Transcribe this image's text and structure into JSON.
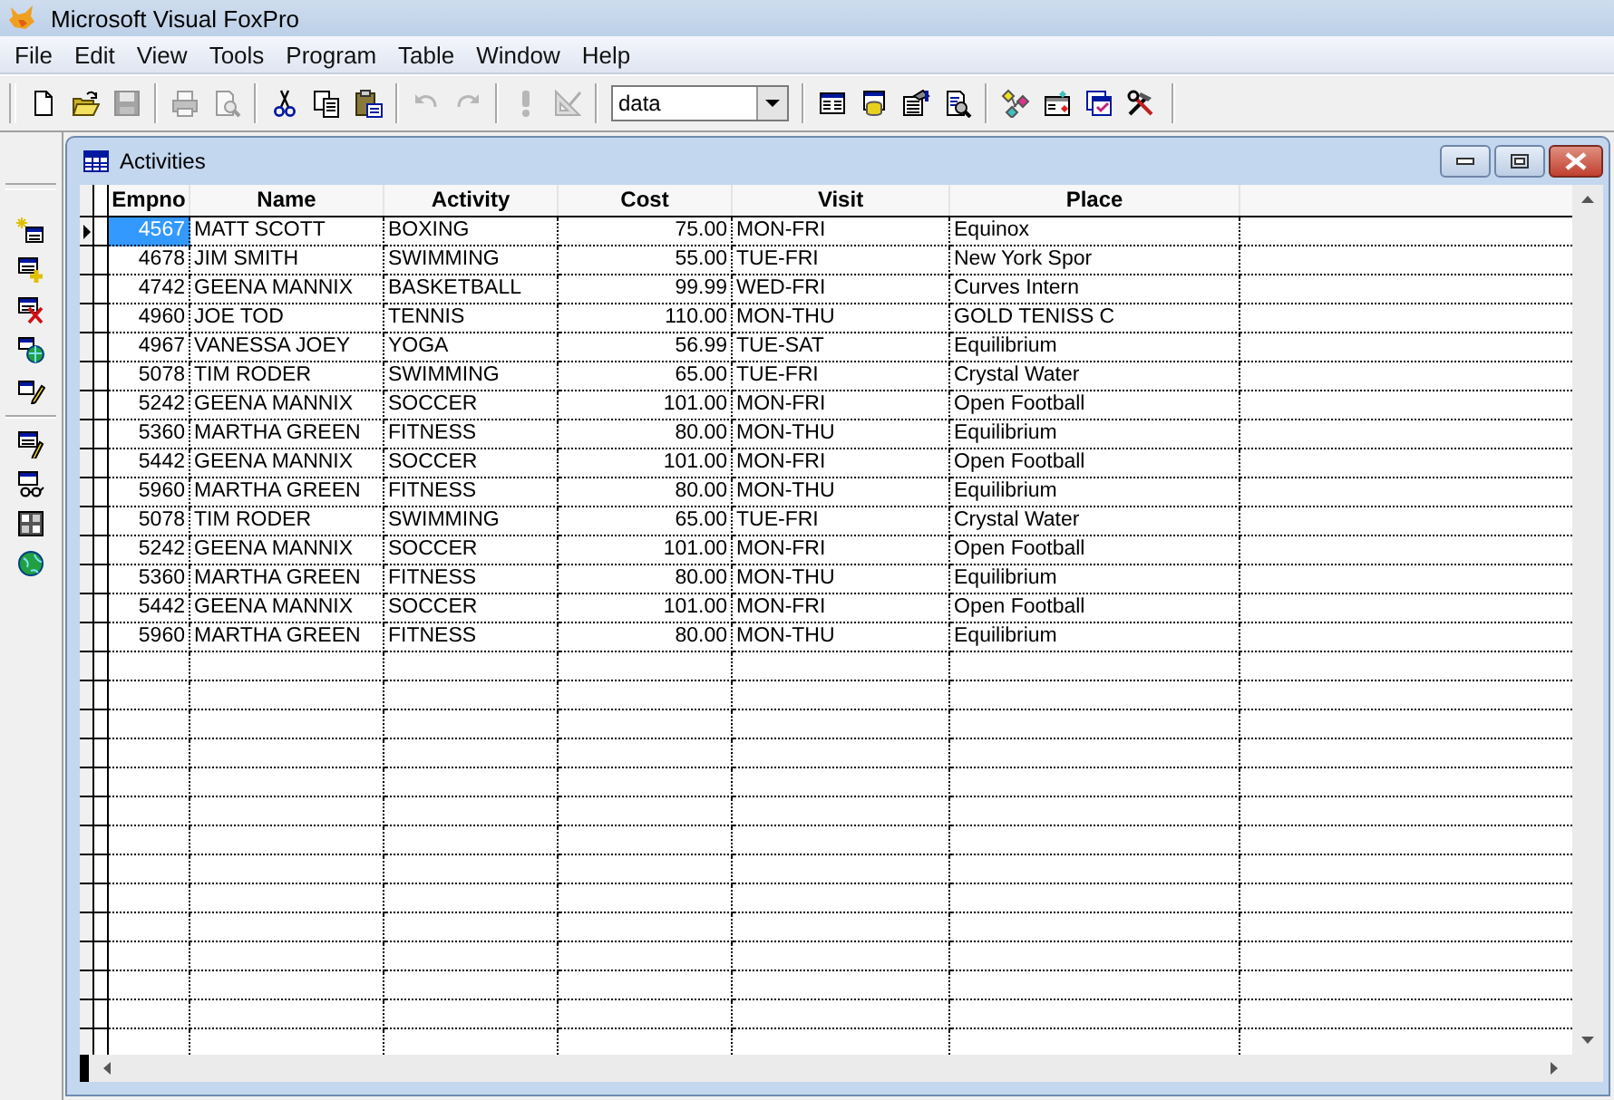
{
  "app": {
    "title": "Microsoft Visual FoxPro"
  },
  "menu": [
    "File",
    "Edit",
    "View",
    "Tools",
    "Program",
    "Table",
    "Window",
    "Help"
  ],
  "toolbar": [
    {
      "kind": "new",
      "disabled": false
    },
    {
      "kind": "open",
      "disabled": false
    },
    {
      "kind": "save",
      "disabled": true
    },
    {
      "kind": "separator"
    },
    {
      "kind": "print",
      "disabled": true
    },
    {
      "kind": "preview",
      "disabled": true
    },
    {
      "kind": "separator"
    },
    {
      "kind": "cut",
      "disabled": false
    },
    {
      "kind": "copy",
      "disabled": false
    },
    {
      "kind": "paste",
      "disabled": false
    },
    {
      "kind": "separator"
    },
    {
      "kind": "undo",
      "disabled": true
    },
    {
      "kind": "redo",
      "disabled": true
    },
    {
      "kind": "separator"
    },
    {
      "kind": "run",
      "disabled": true
    },
    {
      "kind": "modify",
      "disabled": true
    },
    {
      "kind": "separator"
    },
    {
      "kind": "combo",
      "value": "data"
    },
    {
      "kind": "separator"
    },
    {
      "kind": "command",
      "disabled": false
    },
    {
      "kind": "datasession",
      "disabled": false
    },
    {
      "kind": "properties",
      "disabled": false
    },
    {
      "kind": "report",
      "disabled": false
    },
    {
      "kind": "separator"
    },
    {
      "kind": "connect",
      "disabled": false
    },
    {
      "kind": "wizard",
      "disabled": false
    },
    {
      "kind": "formdesign",
      "disabled": false
    },
    {
      "kind": "tools",
      "disabled": false
    }
  ],
  "side_toolbar": [
    {
      "kind": "newclass"
    },
    {
      "kind": "add"
    },
    {
      "kind": "remove"
    },
    {
      "kind": "browse"
    },
    {
      "kind": "modifywin"
    },
    {
      "kind": "separator"
    },
    {
      "kind": "edit"
    },
    {
      "kind": "view"
    },
    {
      "kind": "binary"
    },
    {
      "kind": "globe"
    }
  ],
  "window": {
    "title": "Activities",
    "columns": [
      {
        "label": "Empno",
        "numeric": true
      },
      {
        "label": "Name",
        "numeric": false
      },
      {
        "label": "Activity",
        "numeric": false
      },
      {
        "label": "Cost",
        "numeric": true
      },
      {
        "label": "Visit",
        "numeric": false
      },
      {
        "label": "Place",
        "numeric": false
      }
    ],
    "rows": [
      {
        "selected": true,
        "cells": [
          "4567",
          "MATT SCOTT",
          "BOXING",
          "75.00",
          "MON-FRI",
          "Equinox"
        ]
      },
      {
        "selected": false,
        "cells": [
          "4678",
          "JIM SMITH",
          "SWIMMING",
          "55.00",
          "TUE-FRI",
          "New York Spor"
        ]
      },
      {
        "selected": false,
        "cells": [
          "4742",
          "GEENA MANNIX",
          "BASKETBALL",
          "99.99",
          "WED-FRI",
          "Curves Intern"
        ]
      },
      {
        "selected": false,
        "cells": [
          "4960",
          "JOE TOD",
          "TENNIS",
          "110.00",
          "MON-THU",
          "GOLD TENISS C"
        ]
      },
      {
        "selected": false,
        "cells": [
          "4967",
          "VANESSA JOEY",
          "YOGA",
          "56.99",
          "TUE-SAT",
          "Equilibrium"
        ]
      },
      {
        "selected": false,
        "cells": [
          "5078",
          "TIM RODER",
          "SWIMMING",
          "65.00",
          "TUE-FRI",
          "Crystal Water"
        ]
      },
      {
        "selected": false,
        "cells": [
          "5242",
          "GEENA MANNIX",
          "SOCCER",
          "101.00",
          "MON-FRI",
          "Open Football"
        ]
      },
      {
        "selected": false,
        "cells": [
          "5360",
          "MARTHA GREEN",
          "FITNESS",
          "80.00",
          "MON-THU",
          "Equilibrium"
        ]
      },
      {
        "selected": false,
        "cells": [
          "5442",
          "GEENA MANNIX",
          "SOCCER",
          "101.00",
          "MON-FRI",
          "Open Football"
        ]
      },
      {
        "selected": false,
        "cells": [
          "5960",
          "MARTHA GREEN",
          "FITNESS",
          "80.00",
          "MON-THU",
          "Equilibrium"
        ]
      },
      {
        "selected": false,
        "cells": [
          "5078",
          "TIM RODER",
          "SWIMMING",
          "65.00",
          "TUE-FRI",
          "Crystal Water"
        ]
      },
      {
        "selected": false,
        "cells": [
          "5242",
          "GEENA MANNIX",
          "SOCCER",
          "101.00",
          "MON-FRI",
          "Open Football"
        ]
      },
      {
        "selected": false,
        "cells": [
          "5360",
          "MARTHA GREEN",
          "FITNESS",
          "80.00",
          "MON-THU",
          "Equilibrium"
        ]
      },
      {
        "selected": false,
        "cells": [
          "5442",
          "GEENA MANNIX",
          "SOCCER",
          "101.00",
          "MON-FRI",
          "Open Football"
        ]
      },
      {
        "selected": false,
        "cells": [
          "5960",
          "MARTHA GREEN",
          "FITNESS",
          "80.00",
          "MON-THU",
          "Equilibrium"
        ]
      }
    ]
  }
}
